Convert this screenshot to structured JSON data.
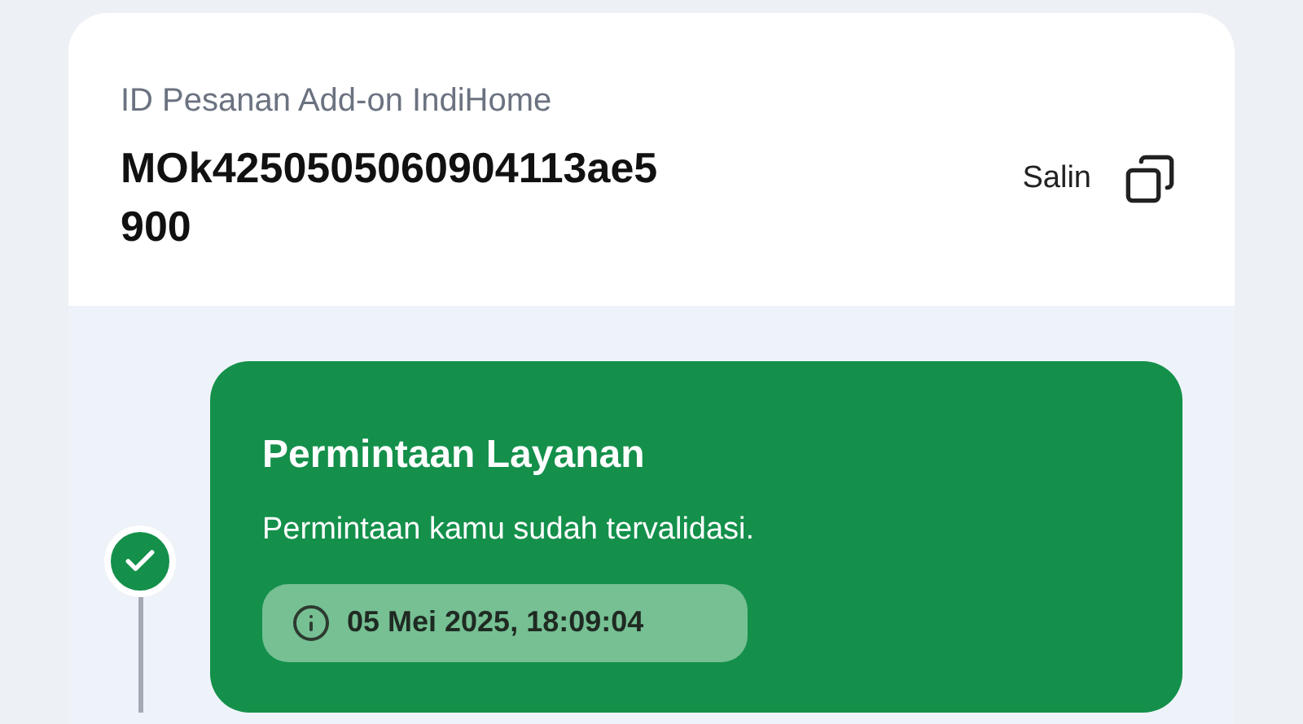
{
  "order": {
    "label": "ID Pesanan Add-on IndiHome",
    "id": "MOk4250505060904113ae5900",
    "copy_label": "Salin"
  },
  "timeline": [
    {
      "title": "Permintaan Layanan",
      "description": "Permintaan kamu sudah tervalidasi.",
      "timestamp": "05 Mei 2025, 18:09:04",
      "done": true
    }
  ]
}
